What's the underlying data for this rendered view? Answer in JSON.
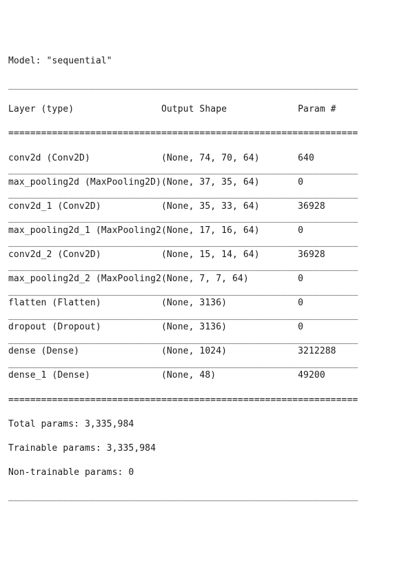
{
  "summary": {
    "model_line": "Model: \"sequential\"",
    "header": {
      "layer": "Layer (type)",
      "output_shape": "Output Shape",
      "param": "Param #"
    },
    "columns": {
      "c1": 28,
      "c2": 25,
      "total": 64
    },
    "layers": [
      {
        "name": "conv2d (Conv2D)",
        "output": "(None, 74, 70, 64)",
        "param": "640"
      },
      {
        "name": "max_pooling2d (MaxPooling2D)",
        "output": "(None, 37, 35, 64)",
        "param": "0"
      },
      {
        "name": "conv2d_1 (Conv2D)",
        "output": "(None, 35, 33, 64)",
        "param": "36928"
      },
      {
        "name": "max_pooling2d_1 (MaxPooling2",
        "output": "(None, 17, 16, 64)",
        "param": "0"
      },
      {
        "name": "conv2d_2 (Conv2D)",
        "output": "(None, 15, 14, 64)",
        "param": "36928"
      },
      {
        "name": "max_pooling2d_2 (MaxPooling2",
        "output": "(None, 7, 7, 64)",
        "param": "0"
      },
      {
        "name": "flatten (Flatten)",
        "output": "(None, 3136)",
        "param": "0"
      },
      {
        "name": "dropout (Dropout)",
        "output": "(None, 3136)",
        "param": "0"
      },
      {
        "name": "dense (Dense)",
        "output": "(None, 1024)",
        "param": "3212288"
      },
      {
        "name": "dense_1 (Dense)",
        "output": "(None, 48)",
        "param": "49200"
      }
    ],
    "footer": {
      "total": "Total params: 3,335,984",
      "trainable": "Trainable params: 3,335,984",
      "nontrainable": "Non-trainable params: 0"
    }
  }
}
